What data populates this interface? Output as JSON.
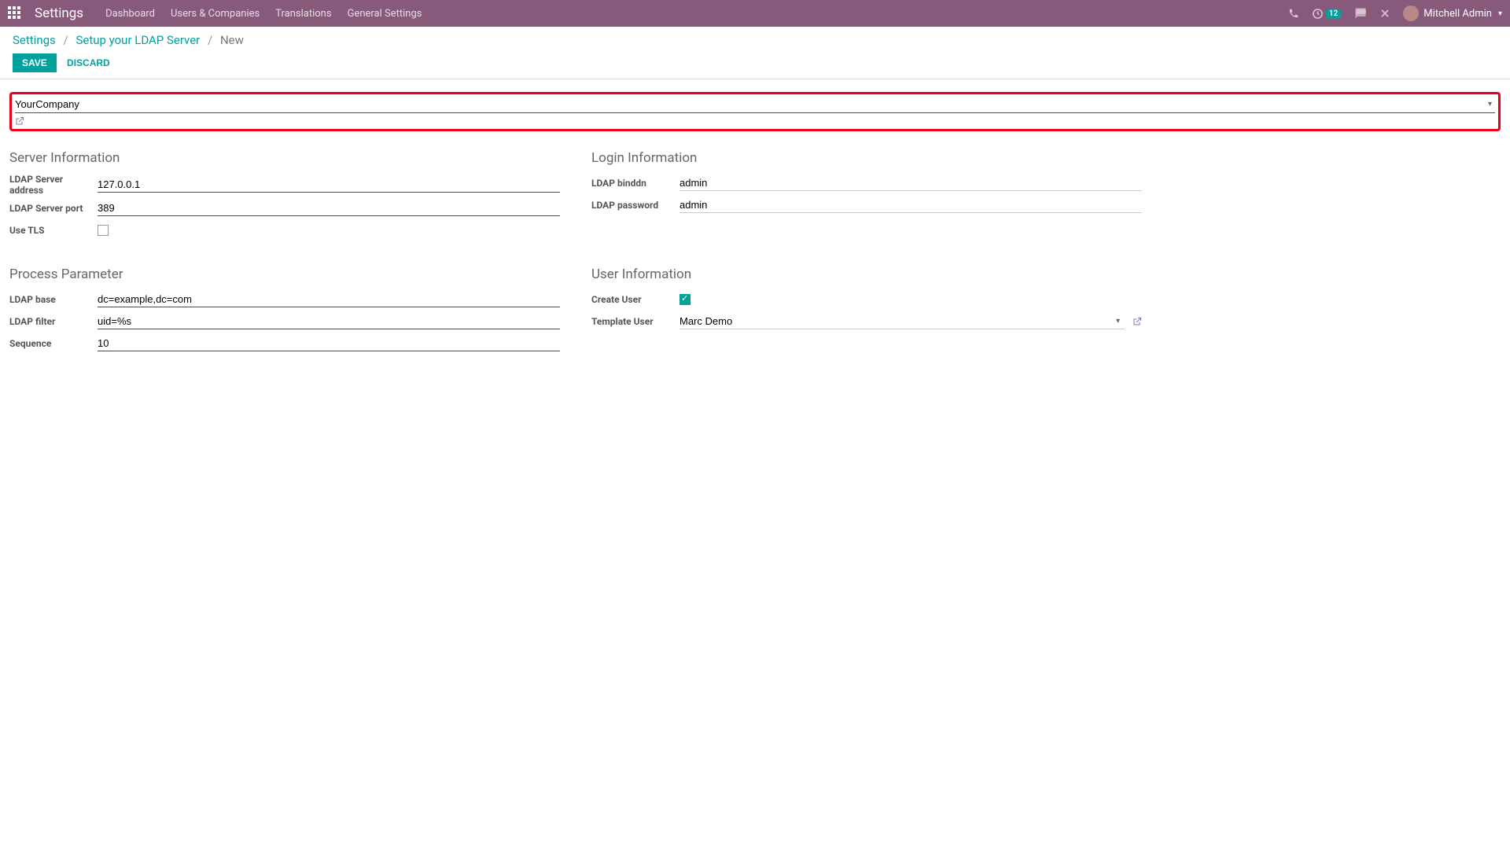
{
  "navbar": {
    "title": "Settings",
    "menu": [
      "Dashboard",
      "Users & Companies",
      "Translations",
      "General Settings"
    ],
    "badge_count": "12",
    "user_name": "Mitchell Admin"
  },
  "breadcrumb": {
    "items": [
      "Settings",
      "Setup your LDAP Server"
    ],
    "current": "New"
  },
  "buttons": {
    "save": "SAVE",
    "discard": "DISCARD"
  },
  "company": {
    "value": "YourCompany"
  },
  "sections": {
    "server_info": {
      "title": "Server Information",
      "address_label": "LDAP Server address",
      "address_value": "127.0.0.1",
      "port_label": "LDAP Server port",
      "port_value": "389",
      "tls_label": "Use TLS",
      "tls_checked": false
    },
    "login_info": {
      "title": "Login Information",
      "binddn_label": "LDAP binddn",
      "binddn_value": "admin",
      "password_label": "LDAP password",
      "password_value": "admin"
    },
    "process_param": {
      "title": "Process Parameter",
      "base_label": "LDAP base",
      "base_value": "dc=example,dc=com",
      "filter_label": "LDAP filter",
      "filter_value": "uid=%s",
      "sequence_label": "Sequence",
      "sequence_value": "10"
    },
    "user_info": {
      "title": "User Information",
      "create_user_label": "Create User",
      "create_user_checked": true,
      "template_user_label": "Template User",
      "template_user_value": "Marc Demo"
    }
  }
}
